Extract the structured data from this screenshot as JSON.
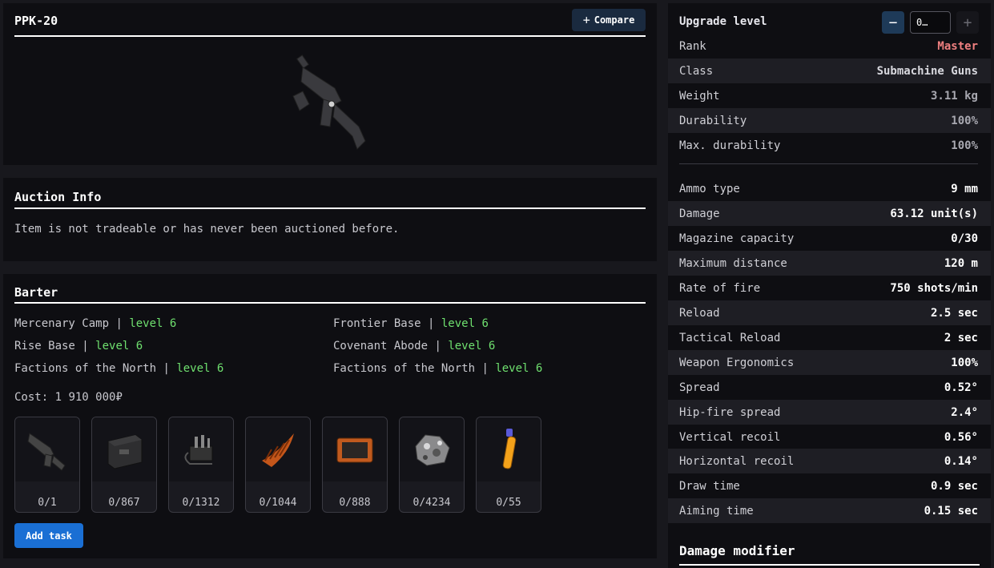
{
  "item": {
    "name": "PPK-20",
    "compare_label": "Compare"
  },
  "auction": {
    "title": "Auction Info",
    "text": "Item is not tradeable or has never been auctioned before."
  },
  "barter": {
    "title": "Barter",
    "rows": [
      {
        "name": "Mercenary Camp",
        "level": "level 6"
      },
      {
        "name": "Frontier Base",
        "level": "level 6"
      },
      {
        "name": "Rise Base",
        "level": "level 6"
      },
      {
        "name": "Covenant Abode",
        "level": "level 6"
      },
      {
        "name": "Factions of the North",
        "level": "level 6"
      },
      {
        "name": "Factions of the North",
        "level": "level 6"
      }
    ],
    "cost_label": "Cost:",
    "cost_value": "1 910 000₽",
    "items": [
      {
        "icon": "smg-icon",
        "count": "0/1"
      },
      {
        "icon": "ammo-box-icon",
        "count": "0/867"
      },
      {
        "icon": "device-icon",
        "count": "0/1312"
      },
      {
        "icon": "fern-icon",
        "count": "0/1044"
      },
      {
        "icon": "tablet-icon",
        "count": "0/888"
      },
      {
        "icon": "ore-icon",
        "count": "0/4234"
      },
      {
        "icon": "vial-icon",
        "count": "0/55"
      }
    ],
    "add_task_label": "Add task"
  },
  "stats": {
    "upgrade_label": "Upgrade level",
    "upgrade_value": "0…",
    "basic": [
      {
        "key": "Rank",
        "value": "Master"
      },
      {
        "key": "Class",
        "value": "Submachine Guns"
      },
      {
        "key": "Weight",
        "value": "3.11 kg"
      },
      {
        "key": "Durability",
        "value": "100%"
      },
      {
        "key": "Max. durability",
        "value": "100%"
      }
    ],
    "weapon": [
      {
        "key": "Ammo type",
        "value": "9 mm"
      },
      {
        "key": "Damage",
        "value": "63.12 unit(s)"
      },
      {
        "key": "Magazine capacity",
        "value": "0/30"
      },
      {
        "key": "Maximum distance",
        "value": "120 m"
      },
      {
        "key": "Rate of fire",
        "value": "750 shots/min"
      },
      {
        "key": "Reload",
        "value": "2.5 sec"
      },
      {
        "key": "Tactical Reload",
        "value": "2 sec"
      },
      {
        "key": "Weapon Ergonomics",
        "value": "100%"
      },
      {
        "key": "Spread",
        "value": "0.52°"
      },
      {
        "key": "Hip-fire spread",
        "value": "2.4°"
      },
      {
        "key": "Vertical recoil",
        "value": "0.56°"
      },
      {
        "key": "Horizontal recoil",
        "value": "0.14°"
      },
      {
        "key": "Draw time",
        "value": "0.9 sec"
      },
      {
        "key": "Aiming time",
        "value": "0.15 sec"
      }
    ],
    "damage_modifier_title": "Damage modifier"
  },
  "colors": {
    "level_green": "#6fe06f",
    "rank_red": "#f08080",
    "button_blue": "#1a6fd4"
  }
}
